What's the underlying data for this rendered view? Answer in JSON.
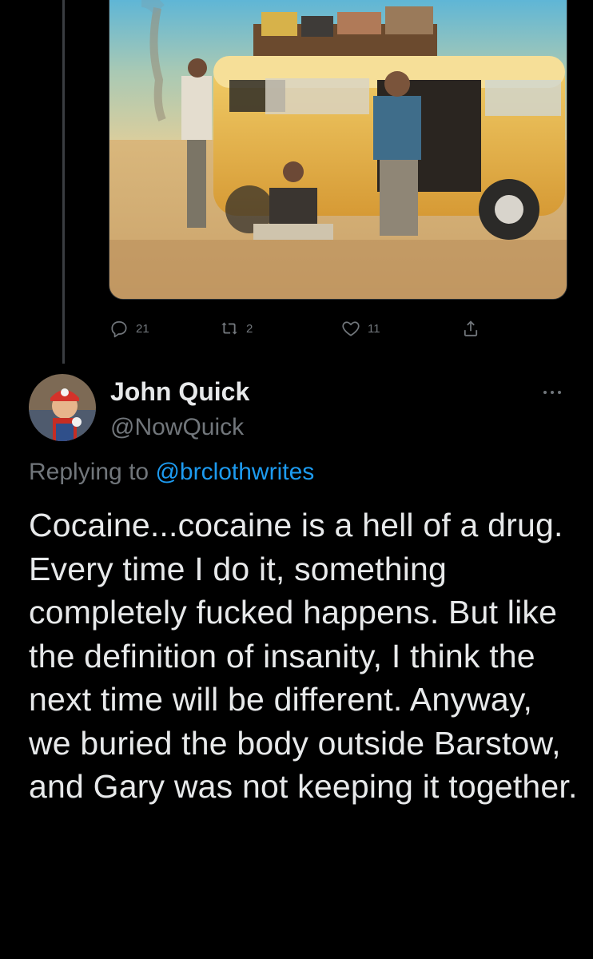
{
  "previous_tweet": {
    "media": {
      "alt": "Three men posing beside a yellow camper van loaded with luggage in a desert, with a tornado in the distance"
    },
    "actions": {
      "reply_count": "21",
      "retweet_count": "2",
      "like_count": "11"
    },
    "icons": [
      "reply-icon",
      "retweet-icon",
      "like-icon",
      "share-icon"
    ]
  },
  "tweet": {
    "display_name": "John Quick",
    "handle": "@NowQuick",
    "replying_prefix": "Replying to ",
    "replying_to": "@brclothwrites",
    "text": "Cocaine...cocaine is a hell of a drug. Every time I do it, something completely fucked happens. But like the definition of insanity, I think the next time will be different. Anyway, we buried the body outside Barstow, and Gary was not keeping it together."
  },
  "colors": {
    "background": "#000000",
    "text_primary": "#e7e9ea",
    "text_secondary": "#71767b",
    "link": "#1d9bf0",
    "thread_line": "#3a3d41"
  }
}
